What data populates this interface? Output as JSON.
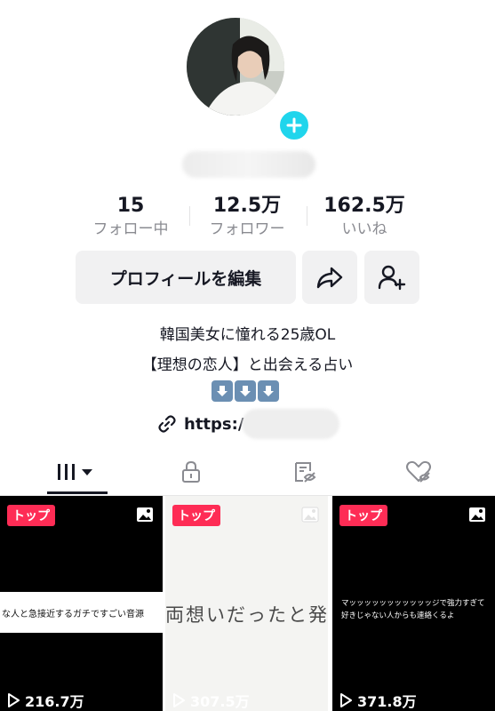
{
  "profile": {
    "stats": [
      {
        "value": "15",
        "label": "フォロー中"
      },
      {
        "value": "12.5万",
        "label": "フォロワー"
      },
      {
        "value": "162.5万",
        "label": "いいね"
      }
    ],
    "edit_button": "プロフィールを編集",
    "bio_line1": "韓国美女に憧れる25歳OL",
    "bio_line2": "【理想の恋人】と出会える占い",
    "link_prefix": "https:/"
  },
  "tabs": [
    {
      "icon": "grid-icon",
      "active": true
    },
    {
      "icon": "lock-icon"
    },
    {
      "icon": "hidden-posts-icon"
    },
    {
      "icon": "liked-icon"
    }
  ],
  "videos": [
    {
      "badge": "トップ",
      "caption": "な人と急接近するガチですごい音源",
      "views": "216.7万"
    },
    {
      "badge": "トップ",
      "caption": "両想いだったと発覚",
      "views": "307.5万"
    },
    {
      "badge": "トップ",
      "caption": "マッッッッッッッッッッッジで強力すぎて好きじゃない人からも連絡くるよ",
      "views": "371.8万"
    }
  ],
  "colors": {
    "accent": "#fe2c55",
    "plus": "#20d5ec"
  }
}
